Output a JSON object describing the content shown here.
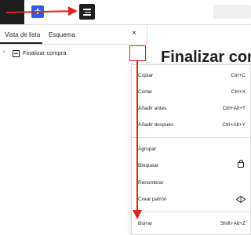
{
  "toolbar": {
    "add_symbol": "+"
  },
  "panel": {
    "tabs": [
      "Vista de lista",
      "Esquema"
    ],
    "close_symbol": "×",
    "tree": [
      {
        "chevron": "›",
        "label": "Finalizar compra"
      }
    ]
  },
  "editor": {
    "title": "Finalizar compra"
  },
  "menu": {
    "groups": [
      [
        {
          "label": "Copiar",
          "shortcut": "Ctrl+C"
        },
        {
          "label": "Cortar",
          "shortcut": "Ctrl+X"
        },
        {
          "label": "Añadir antes",
          "shortcut": "Ctrl+Alt+T"
        },
        {
          "label": "Añadir después",
          "shortcut": "Ctrl+Alt+Y"
        }
      ],
      [
        {
          "label": "Agrupar"
        },
        {
          "label": "Bloquear",
          "icon": "lock-icon"
        },
        {
          "label": "Renombrar"
        },
        {
          "label": "Crear patrón",
          "icon": "pattern-icon"
        }
      ],
      [
        {
          "label": "Borrar",
          "shortcut": "Shift+Alt+Z"
        }
      ]
    ]
  },
  "colors": {
    "accent": "#3858e9",
    "annotation": "#e0211d",
    "dark": "#1e1e1e"
  }
}
